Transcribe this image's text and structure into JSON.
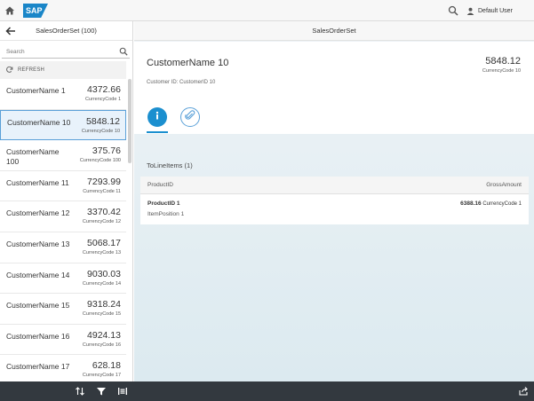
{
  "shell": {
    "logo_text": "SAP",
    "user_label": "Default User",
    "icons": {
      "home": "home-icon",
      "search": "search-icon",
      "user": "user-icon"
    }
  },
  "master": {
    "title": "SalesOrderSet (100)",
    "search_placeholder": "Search",
    "refresh_label": "REFRESH",
    "items": [
      {
        "name": "CustomerName 1",
        "amount": "4372.66",
        "currency": "CurrencyCode 1",
        "selected": false
      },
      {
        "name": "CustomerName 10",
        "amount": "5848.12",
        "currency": "CurrencyCode 10",
        "selected": true
      },
      {
        "name": "CustomerName 100",
        "amount": "375.76",
        "currency": "CurrencyCode 100",
        "selected": false
      },
      {
        "name": "CustomerName 11",
        "amount": "7293.99",
        "currency": "CurrencyCode 11",
        "selected": false
      },
      {
        "name": "CustomerName 12",
        "amount": "3370.42",
        "currency": "CurrencyCode 12",
        "selected": false
      },
      {
        "name": "CustomerName 13",
        "amount": "5068.17",
        "currency": "CurrencyCode 13",
        "selected": false
      },
      {
        "name": "CustomerName 14",
        "amount": "9030.03",
        "currency": "CurrencyCode 14",
        "selected": false
      },
      {
        "name": "CustomerName 15",
        "amount": "9318.24",
        "currency": "CurrencyCode 15",
        "selected": false
      },
      {
        "name": "CustomerName 16",
        "amount": "4924.13",
        "currency": "CurrencyCode 16",
        "selected": false
      },
      {
        "name": "CustomerName 17",
        "amount": "628.18",
        "currency": "CurrencyCode 17",
        "selected": false
      }
    ]
  },
  "detail": {
    "page_title": "SalesOrderSet",
    "object_title": "CustomerName 10",
    "object_amount": "5848.12",
    "object_currency": "CurrencyCode 10",
    "attribute": "Customer ID: CustomerID 10",
    "tabs": [
      {
        "name": "info",
        "icon": "info-icon",
        "selected": true
      },
      {
        "name": "attachments",
        "icon": "paperclip-icon",
        "selected": false
      }
    ],
    "section_title": "ToLineItems (1)",
    "table": {
      "columns": [
        "ProductID",
        "GrossAmount"
      ],
      "rows": [
        {
          "product_id": "ProductID 1",
          "position": "ItemPosition 1",
          "gross_amount": "6388.16",
          "currency": "CurrencyCode 1"
        }
      ]
    }
  },
  "footer": {
    "icons": [
      "sort-icon",
      "filter-icon",
      "group-icon",
      "share-icon"
    ]
  },
  "colors": {
    "accent": "#1b8fcf",
    "shell_bg": "#f7f7f7",
    "footer_bg": "#33393f",
    "selected_bg": "#e8f2fb"
  }
}
